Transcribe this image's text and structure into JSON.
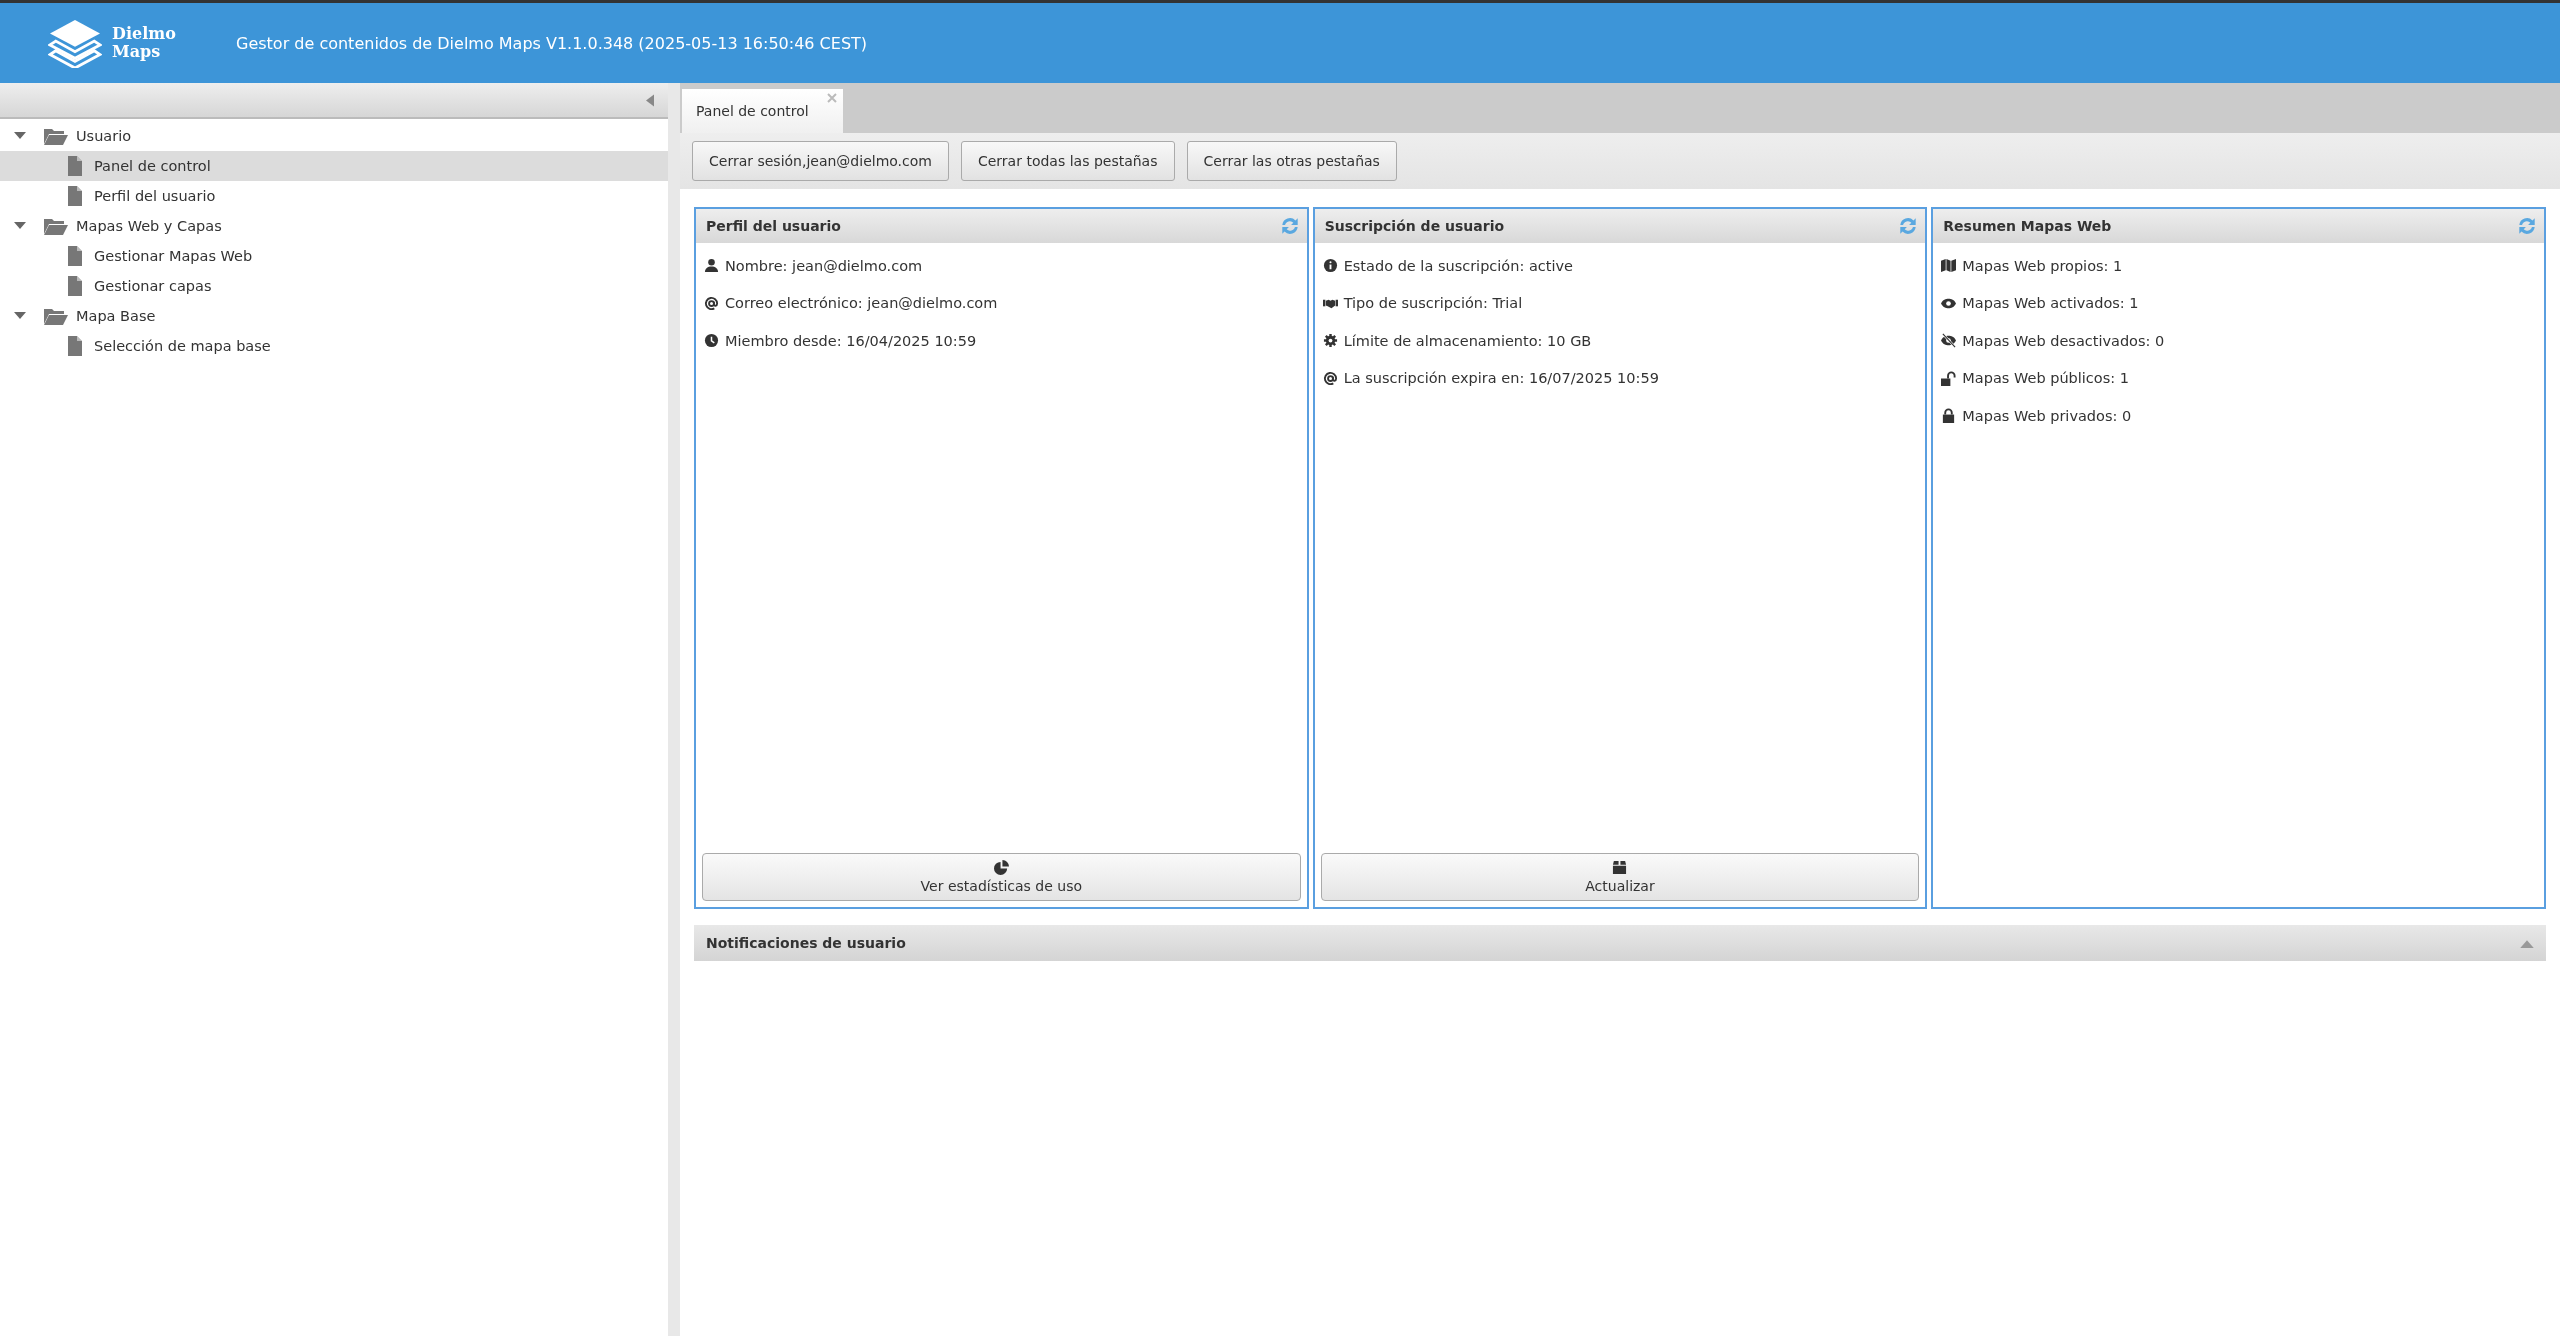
{
  "header": {
    "logo_text": [
      "Dielmo",
      "Maps"
    ],
    "title": "Gestor de contenidos de Dielmo Maps V1.1.0.348 (2025-05-13 16:50:46 CEST)"
  },
  "sidebar": {
    "tree": [
      {
        "label": "Usuario",
        "expanded": true,
        "children": [
          {
            "label": "Panel de control",
            "selected": true
          },
          {
            "label": "Perfil del usuario",
            "selected": false
          }
        ]
      },
      {
        "label": "Mapas Web y Capas",
        "expanded": true,
        "children": [
          {
            "label": "Gestionar Mapas Web",
            "selected": false
          },
          {
            "label": "Gestionar capas",
            "selected": false
          }
        ]
      },
      {
        "label": "Mapa Base",
        "expanded": true,
        "children": [
          {
            "label": "Selección de mapa base",
            "selected": false
          }
        ]
      }
    ]
  },
  "tabs": [
    {
      "label": "Panel de control",
      "selected": true
    }
  ],
  "toolbar": {
    "buttons": [
      "Cerrar sesión,jean@dielmo.com",
      "Cerrar todas las pestañas",
      "Cerrar las otras pestañas"
    ]
  },
  "panels": [
    {
      "title": "Perfil del usuario",
      "rows": [
        "Nombre: jean@dielmo.com",
        "Correo electrónico: jean@dielmo.com",
        "Miembro desde: 16/04/2025 10:59"
      ],
      "button": "Ver estadísticas de uso"
    },
    {
      "title": "Suscripción de usuario",
      "rows": [
        "Estado de la suscripción: active",
        "Tipo de suscripción: Trial",
        "Límite de almacenamiento: 10 GB",
        "La suscripción expira en: 16/07/2025 10:59"
      ],
      "button": "Actualizar"
    },
    {
      "title": "Resumen Mapas Web",
      "rows": [
        "Mapas Web propios: 1",
        "Mapas Web activados: 1",
        "Mapas Web desactivados: 0",
        "Mapas Web públicos: 1",
        "Mapas Web privados: 0"
      ]
    }
  ],
  "notifications": {
    "title": "Notificaciones de usuario"
  }
}
